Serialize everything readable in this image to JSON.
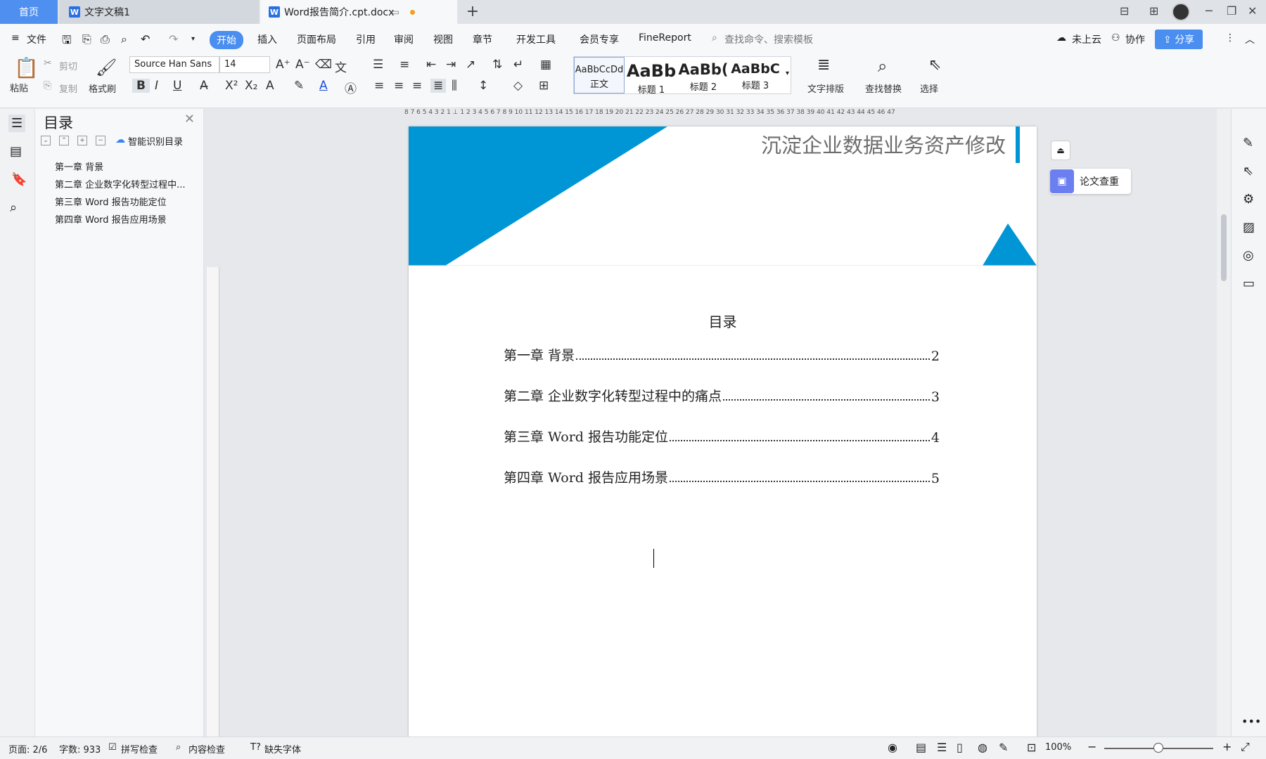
{
  "titlebar": {
    "tabs": [
      {
        "label": "首页"
      },
      {
        "label": "文字文稿1"
      },
      {
        "label": "Word报告简介.cpt.docx"
      }
    ],
    "add_tab": "+"
  },
  "menubar": {
    "file": "文件",
    "items": [
      "开始",
      "插入",
      "页面布局",
      "引用",
      "审阅",
      "视图",
      "章节",
      "开发工具",
      "会员专享",
      "FineReport"
    ],
    "search_placeholder": "查找命令、搜索模板",
    "cloud": "未上云",
    "collab": "协作",
    "share": "分享"
  },
  "ribbon": {
    "paste": "粘贴",
    "cut": "剪切",
    "copy": "复制",
    "format_painter": "格式刷",
    "font_name": "Source Han Sans",
    "font_size": "14",
    "styles": [
      {
        "sample": "AaBbCcDd",
        "name": "正文"
      },
      {
        "sample": "AaBb",
        "name": "标题 1"
      },
      {
        "sample": "AaBb(",
        "name": "标题 2"
      },
      {
        "sample": "AaBbC",
        "name": "标题 3"
      }
    ],
    "text_layout": "文字排版",
    "find_replace": "查找替换",
    "select": "选择"
  },
  "nav": {
    "title": "目录",
    "smart": "智能识别目录",
    "entries": [
      "第一章  背景",
      "第二章  企业数字化转型过程中...",
      "第三章  Word 报告功能定位",
      "第四章  Word 报告应用场景"
    ]
  },
  "ruler": {
    "h": "8 7 6 5 4 3 2 1 ⊥ 1 2 3 4 5 6 7 8 9 10 11 12 13 14 15 16 17 18 19 20 21 22 23 24 25 26 27 28 29 30 31 32 33 34 35 36 37 38 39 40 41 42 43 44 45 46 47"
  },
  "document": {
    "banner_title": "沉淀企业数据业务资产修改",
    "toc_heading": "目录",
    "toc": [
      {
        "label": "第一章  背景",
        "page": "2"
      },
      {
        "label": "第二章  企业数字化转型过程中的痛点",
        "page": "3"
      },
      {
        "label": "第三章  Word 报告功能定位",
        "page": "4"
      },
      {
        "label": "第四章  Word 报告应用场景",
        "page": "5"
      }
    ]
  },
  "side": {
    "plagiarism": "论文查重"
  },
  "status": {
    "page": "页面: 2/6",
    "words": "字数: 933",
    "spell": "拼写检查",
    "content": "内容检查",
    "missing_font": "缺失字体",
    "zoom": "100%"
  },
  "colors": {
    "accent": "#4a8ef0",
    "banner_blue": "#0096d6"
  }
}
